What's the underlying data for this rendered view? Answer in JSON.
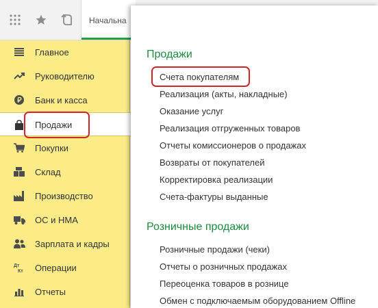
{
  "toolbar": {
    "home_tab": "Начальна",
    "icons": [
      "apps-grid-icon",
      "star-icon",
      "history-icon"
    ]
  },
  "sidebar": {
    "items": [
      {
        "label": "Главное",
        "icon": "menu-lines-icon"
      },
      {
        "label": "Руководителю",
        "icon": "trend-chart-icon"
      },
      {
        "label": "Банк и касса",
        "icon": "ruble-coin-icon"
      },
      {
        "label": "Продажи",
        "icon": "shopping-bag-icon",
        "active": true
      },
      {
        "label": "Покупки",
        "icon": "shopping-cart-icon"
      },
      {
        "label": "Склад",
        "icon": "warehouse-icon"
      },
      {
        "label": "Производство",
        "icon": "factory-icon"
      },
      {
        "label": "ОС и НМА",
        "icon": "truck-icon"
      },
      {
        "label": "Зарплата и кадры",
        "icon": "people-icon"
      },
      {
        "label": "Операции",
        "icon": "debit-credit-icon"
      },
      {
        "label": "Отчеты",
        "icon": "bar-chart-icon"
      }
    ]
  },
  "panel": {
    "sections": [
      {
        "title": "Продажи",
        "links": [
          "Счета покупателям",
          "Реализация (акты, накладные)",
          "Оказание услуг",
          "Реализация отгруженных товаров",
          "Отчеты комиссионеров о продажах",
          "Возвраты от покупателей",
          "Корректировка реализации",
          "Счета-фактуры выданные"
        ]
      },
      {
        "title": "Розничные продажи",
        "links": [
          "Розничные продажи (чеки)",
          "Отчеты о розничных продажах",
          "Переоценка товаров в рознице",
          "Обмен с подключаемым оборудованием Offline"
        ]
      }
    ]
  },
  "colors": {
    "sidebar_bg": "#fbec88",
    "section_title": "#1e8a3e",
    "highlight_red": "#d0232a",
    "tab_accent": "#26a047"
  }
}
